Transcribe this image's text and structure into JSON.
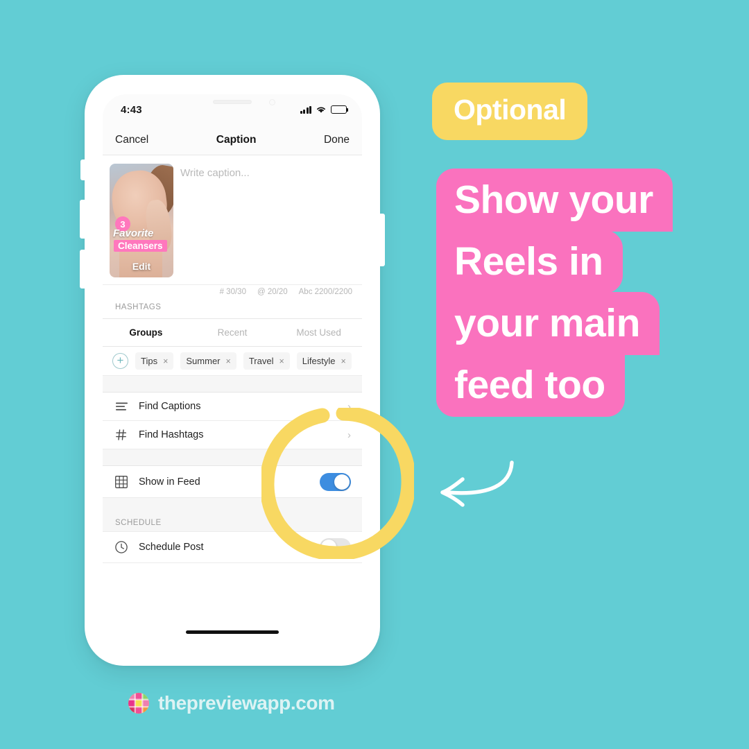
{
  "theme": {
    "background": "#62CDD4",
    "yellow": "#F8D862",
    "pink": "#FA72BE",
    "toggle_on_blue": "#3d8de0",
    "footer_text_color": "#DDF3F4"
  },
  "phone": {
    "status_bar": {
      "time": "4:43",
      "signal_icon": "signal-bars-icon",
      "wifi_icon": "wifi-icon",
      "battery_icon": "battery-icon"
    },
    "nav_bar": {
      "cancel_label": "Cancel",
      "title": "Caption",
      "done_label": "Done"
    },
    "caption": {
      "placeholder": "Write caption...",
      "thumbnail": {
        "badge_number": "3",
        "overlay_line_1": "Favorite",
        "overlay_line_2": "Cleansers",
        "edit_label": "Edit"
      }
    },
    "counters": [
      "# 30/30",
      "@ 20/20",
      "Abc 2200/2200"
    ],
    "hashtags_section_label": "HASHTAGS",
    "tabs": [
      {
        "label": "Groups",
        "active": true
      },
      {
        "label": "Recent",
        "active": false
      },
      {
        "label": "Most Used",
        "active": false
      }
    ],
    "chips": {
      "add_label": "+",
      "items": [
        {
          "label": "Tips",
          "remove": "×"
        },
        {
          "label": "Summer",
          "remove": "×"
        },
        {
          "label": "Travel",
          "remove": "×"
        },
        {
          "label": "Lifestyle",
          "remove": "×"
        }
      ]
    },
    "rows": [
      {
        "label": "Find Captions",
        "icon": "list-lines-icon",
        "chevron": "›"
      },
      {
        "label": "Find Hashtags",
        "icon": "hashtag-icon",
        "chevron": "›"
      }
    ],
    "show_in_feed": {
      "label": "Show in Feed",
      "icon": "grid-icon",
      "toggle_state": "on"
    },
    "schedule_section_label": "SCHEDULE",
    "schedule_post": {
      "label": "Schedule Post",
      "icon": "clock-icon",
      "toggle_state": "off"
    }
  },
  "annotations": {
    "optional_badge": "Optional",
    "headline_lines": [
      "Show your",
      "Reels in",
      "your main",
      "feed too"
    ],
    "arrow_icon": "curved-left-arrow-icon",
    "highlight_ring_icon": "yellow-highlight-circle-icon"
  },
  "footer": {
    "brand_text": "thepreviewapp.com",
    "logo_icon": "preview-app-logo-icon"
  }
}
